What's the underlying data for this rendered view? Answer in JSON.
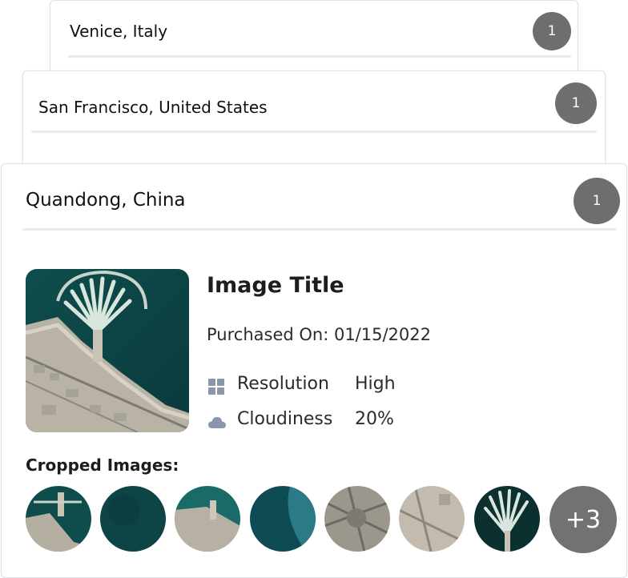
{
  "cards": [
    {
      "location": "Venice, Italy",
      "count": "1"
    },
    {
      "location": "San Francisco, United States",
      "count": "1"
    },
    {
      "location": "Quandong, China",
      "count": "1"
    }
  ],
  "detail": {
    "image_title": "Image Title",
    "purchased_on": "Purchased On: 01/15/2022",
    "resolution_label": "Resolution",
    "resolution_value": "High",
    "cloudiness_label": "Cloudiness",
    "cloudiness_value": "20%",
    "cropped_label": "Cropped Images:",
    "more_count": "+3",
    "icons": {
      "resolution": "grid-icon",
      "cloudiness": "cloud-icon"
    }
  },
  "colors": {
    "badge": "#6e6e6e",
    "divider": "#e7edf3",
    "icon": "#8a96aa"
  }
}
